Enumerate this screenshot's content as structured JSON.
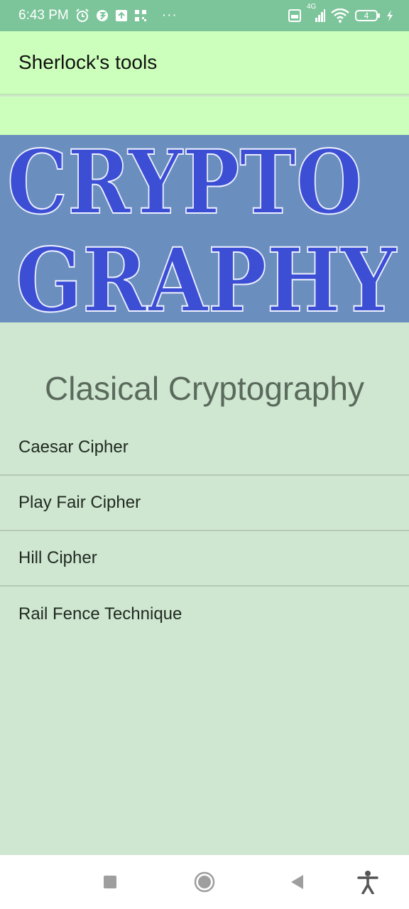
{
  "status_bar": {
    "time": "6:43 PM",
    "more": "···",
    "network": "4G",
    "battery": "4",
    "icons": [
      "alarm-icon",
      "app-notification-icon",
      "upload-icon",
      "qr-icon",
      "volte-icon",
      "signal-icon",
      "wifi-icon",
      "battery-icon",
      "charging-icon"
    ]
  },
  "app_bar": {
    "title": "Sherlock's tools"
  },
  "banner": {
    "line1": "CRYPTO",
    "line2": "GRAPHY",
    "colors": {
      "background": "#6a8fbe",
      "text": "#3c4fd4"
    }
  },
  "section": {
    "title": "Clasical Cryptography"
  },
  "list": {
    "items": [
      {
        "label": "Caesar Cipher"
      },
      {
        "label": "Play Fair Cipher"
      },
      {
        "label": "Hill Cipher"
      },
      {
        "label": "Rail Fence Technique"
      }
    ]
  },
  "nav_bar": {
    "icons": [
      "recents-icon",
      "home-icon",
      "back-icon",
      "accessibility-icon"
    ]
  },
  "colors": {
    "status_bar": "#7cc59a",
    "app_bar": "#ccffbb",
    "content_bg": "#cfe6d0"
  }
}
